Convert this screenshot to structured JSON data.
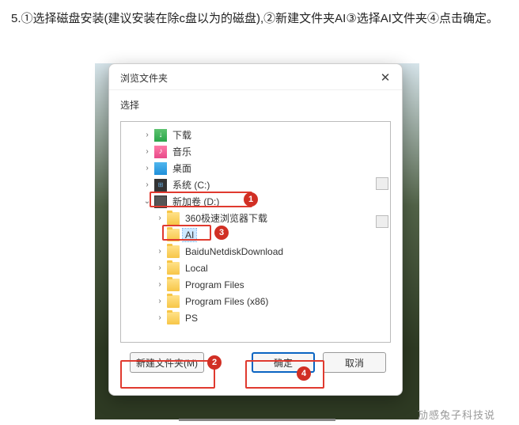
{
  "instruction": "5.①选择磁盘安装(建议安装在除c盘以为的磁盘),②新建文件夹AI③选择AI文件夹④点击确定。",
  "dialog": {
    "title": "浏览文件夹",
    "select_label": "选择",
    "close": "✕",
    "buttons": {
      "new_folder": "新建文件夹(M)",
      "ok": "确定",
      "cancel": "取消"
    }
  },
  "tree": {
    "downloads": "下载",
    "music": "音乐",
    "desktop": "桌面",
    "system_c": "系统 (C:)",
    "drive_d": "新加卷 (D:)",
    "d_children": {
      "browser_dl": "360极速浏览器下载",
      "ai": "AI",
      "baidu": "BaiduNetdiskDownload",
      "local": "Local",
      "pf": "Program Files",
      "pfx86": "Program Files (x86)",
      "ps": "PS"
    }
  },
  "badges": {
    "b1": "1",
    "b2": "2",
    "b3": "3",
    "b4": "4"
  },
  "footer": "劢感兔子科技说"
}
